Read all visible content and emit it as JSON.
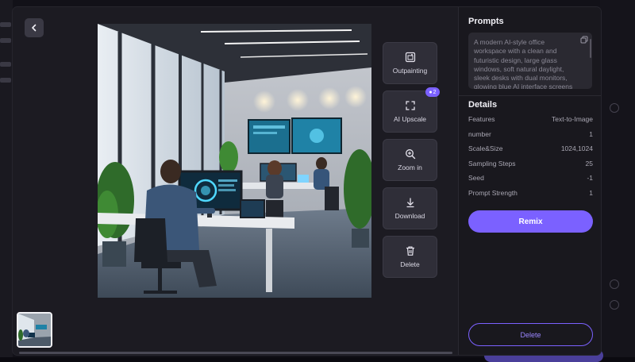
{
  "viewer": {
    "back_icon": "chevron-left-icon",
    "actions": [
      {
        "label": "Outpainting",
        "icon": "outpaint-icon"
      },
      {
        "label": "AI Upscale",
        "icon": "expand-icon",
        "badge": "2"
      },
      {
        "label": "Zoom in",
        "icon": "zoom-in-icon"
      },
      {
        "label": "Download",
        "icon": "download-icon"
      },
      {
        "label": "Delete",
        "icon": "trash-icon"
      }
    ]
  },
  "panel": {
    "prompts_title": "Prompts",
    "prompt_text": "A modern AI-style office workspace with a clean and futuristic design, large glass windows, soft natural daylight, sleek desks with dual monitors, glowing blue AI interface screens",
    "details_title": "Details",
    "details": [
      {
        "key": "Features",
        "value": "Text-to-Image"
      },
      {
        "key": "number",
        "value": "1"
      },
      {
        "key": "Scale&Size",
        "value": "1024,1024"
      },
      {
        "key": "Sampling Steps",
        "value": "25"
      },
      {
        "key": "Seed",
        "value": "-1"
      },
      {
        "key": "Prompt Strength",
        "value": "1"
      }
    ],
    "remix_label": "Remix",
    "delete_label": "Delete"
  },
  "colors": {
    "accent": "#7b61ff",
    "panel_bg": "#19181e",
    "viewer_bg": "#1c1b22"
  }
}
